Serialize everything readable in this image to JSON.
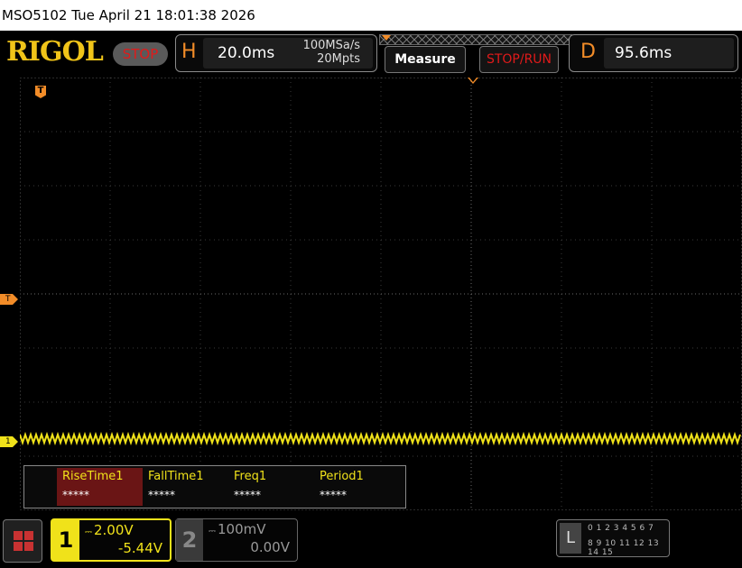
{
  "titlebar": {
    "text": "MSO5102  Tue April 21 18:01:38 2026"
  },
  "header": {
    "logo": "RIGOL",
    "run_state": "STOP",
    "horizontal": {
      "letter": "H",
      "timebase": "20.0ms",
      "sample_rate": "100MSa/s",
      "memory_depth": "20Mpts"
    },
    "measure_label": "Measure",
    "stoprun_label": "STOP/RUN",
    "delay": {
      "letter": "D",
      "value": "95.6ms"
    }
  },
  "markers": {
    "trigger_level": "T",
    "channel1": "1",
    "trigger_position": "T"
  },
  "measurements": [
    {
      "name": "RiseTime1",
      "value": "*****",
      "active": true
    },
    {
      "name": "FallTime1",
      "value": "*****",
      "active": false
    },
    {
      "name": "Freq1",
      "value": "*****",
      "active": false
    },
    {
      "name": "Period1",
      "value": "*****",
      "active": false
    }
  ],
  "channels": {
    "ch1": {
      "number": "1",
      "scale": "2.00V",
      "offset": "-5.44V",
      "color": "#f0e21a"
    },
    "ch2": {
      "number": "2",
      "scale": "100mV",
      "offset": "0.00V",
      "color": "#999999"
    }
  },
  "logic": {
    "label": "L",
    "row1": "0 1 2 3  4 5 6 7",
    "row2": "8 9 10 11  12 13 14 15"
  },
  "colors": {
    "accent": "#f28c28",
    "ch1": "#f0e21a",
    "stop": "#e01a1a",
    "logo": "#f0c419"
  },
  "icons": {
    "dc_coupling": "dc-coupling-icon",
    "home": "home-grid-icon"
  }
}
